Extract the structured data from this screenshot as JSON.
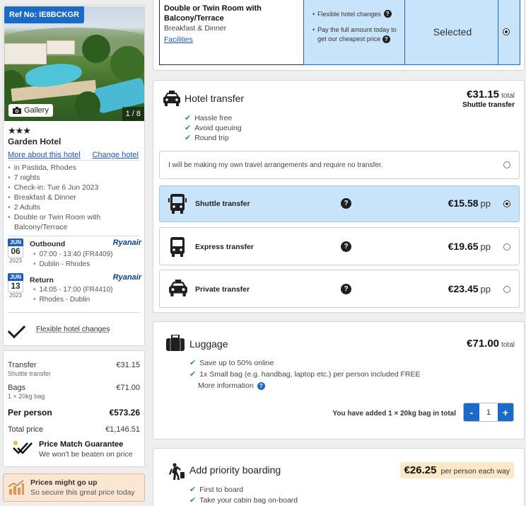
{
  "hotel": {
    "ref_badge": "Ref No: IE8BCKGR",
    "gallery_label": "Gallery",
    "photo_count": "1 / 8",
    "stars": "★★★",
    "name": "Garden Hotel",
    "more_link": "More about this hotel",
    "change_link": "Change hotel",
    "details": [
      "in Pastida, Rhodes",
      "7 nights",
      "Check-in: Tue 6 Jun 2023",
      "Breakfast & Dinner",
      "2 Adults",
      "Double or Twin Room with Balcony/Terrace"
    ]
  },
  "flights": {
    "outbound": {
      "month": "JUN",
      "day": "06",
      "year": "2023",
      "label": "Outbound",
      "airline": "Ryanair",
      "time": "07:00 - 13:40 (FR4409)",
      "route": "Dublin - Rhodes"
    },
    "return": {
      "month": "JUN",
      "day": "13",
      "year": "2023",
      "label": "Return",
      "airline": "Ryanair",
      "time": "14:05 - 17:00 (FR4410)",
      "route": "Rhodes - Dublin"
    }
  },
  "flexible_label": "Flexible hotel changes",
  "price_summary": {
    "transfer_label": "Transfer",
    "transfer_value": "€31.15",
    "transfer_sub": "Shuttle transfer",
    "bags_label": "Bags",
    "bags_value": "€71.00",
    "bags_sub": "1 × 20kg bag",
    "per_person_label": "Per person",
    "per_person_value": "€573.26",
    "total_label": "Total price",
    "total_value": "€1,146.51",
    "guarantee_title": "Price Match Guarantee",
    "guarantee_text": "We won't be beaten on price"
  },
  "warning": {
    "title": "Prices might go up",
    "text": "So secure this great price today"
  },
  "room": {
    "name": "Double or Twin Room with Balcony/Terrace",
    "board": "Breakfast & Dinner",
    "facilities_link": "Facilities",
    "benefit1": "Flexible hotel changes",
    "benefit2": "Pay the full amount today to get our cheapest price",
    "selected_label": "Selected"
  },
  "transfer": {
    "title": "Hotel transfer",
    "price": "€31.15",
    "price_suffix": "total",
    "price_sub": "Shuttle transfer",
    "perks": [
      "Hassle free",
      "Avoid queuing",
      "Round trip"
    ],
    "no_transfer": "I will be making my own travel arrangements and require no transfer.",
    "options": [
      {
        "label": "Shuttle transfer",
        "price": "€15.58",
        "unit": "pp",
        "selected": true
      },
      {
        "label": "Express transfer",
        "price": "€19.65",
        "unit": "pp",
        "selected": false
      },
      {
        "label": "Private transfer",
        "price": "€23.45",
        "unit": "pp",
        "selected": false
      }
    ]
  },
  "luggage": {
    "title": "Luggage",
    "price": "€71.00",
    "price_suffix": "total",
    "perks": [
      "Save up to 50% online",
      "1x Small bag (e.g. handbag, laptop etc.) per person included FREE"
    ],
    "more_info": "More information",
    "added_text": "You have added 1 × 20kg bag in total",
    "qty": "1",
    "minus": "-",
    "plus": "+"
  },
  "priority": {
    "title": "Add priority boarding",
    "price": "€26.25",
    "price_suffix": "per person each way",
    "perks": [
      "First to board",
      "Take your cabin bag on-board"
    ]
  },
  "colors": {
    "brand_blue": "#1a6ac9",
    "selected_bg": "#c8e4fb",
    "check_green": "#2a9d4a",
    "warning_bg": "#fbe6d4"
  }
}
